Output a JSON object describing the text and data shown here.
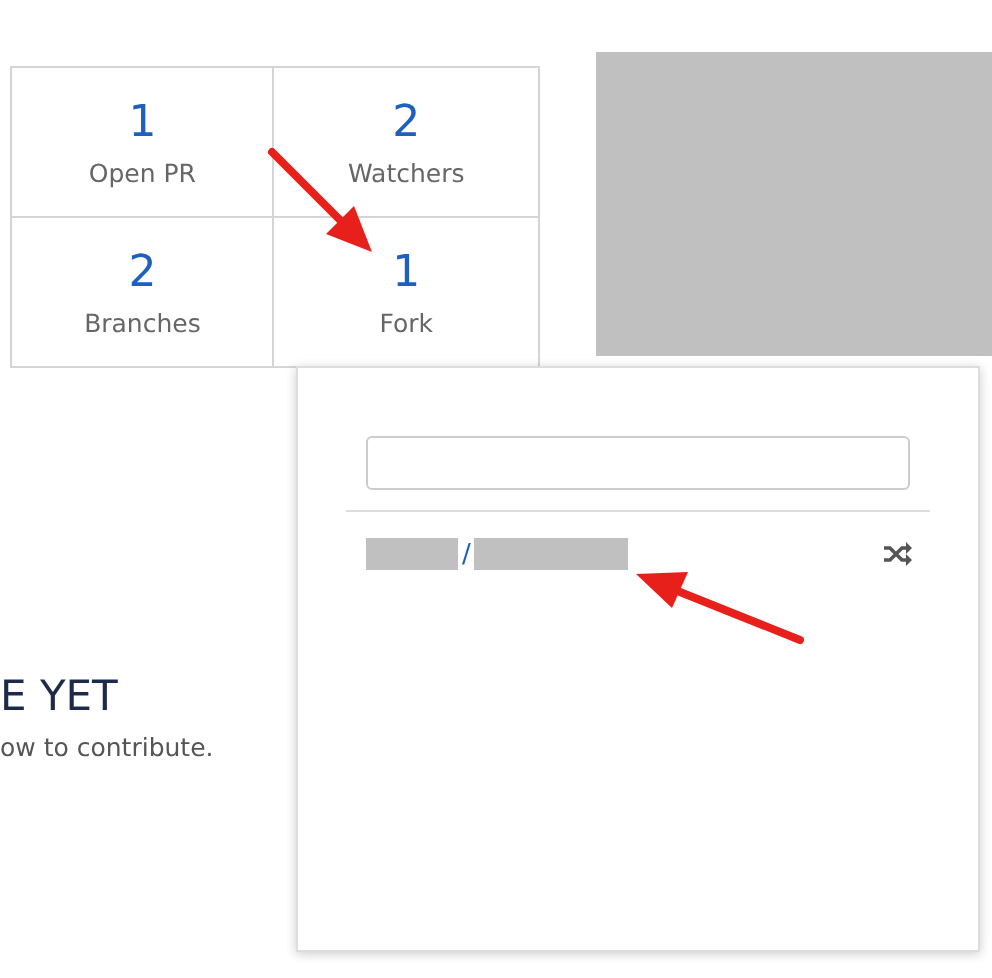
{
  "stats": [
    {
      "value": "1",
      "label": "Open PR"
    },
    {
      "value": "2",
      "label": "Watchers"
    },
    {
      "value": "2",
      "label": "Branches"
    },
    {
      "value": "1",
      "label": "Fork"
    }
  ],
  "empty_state": {
    "heading": "E YET",
    "text": "ow to contribute."
  },
  "fork_dropdown": {
    "items": [
      {
        "separator": "/"
      }
    ]
  }
}
